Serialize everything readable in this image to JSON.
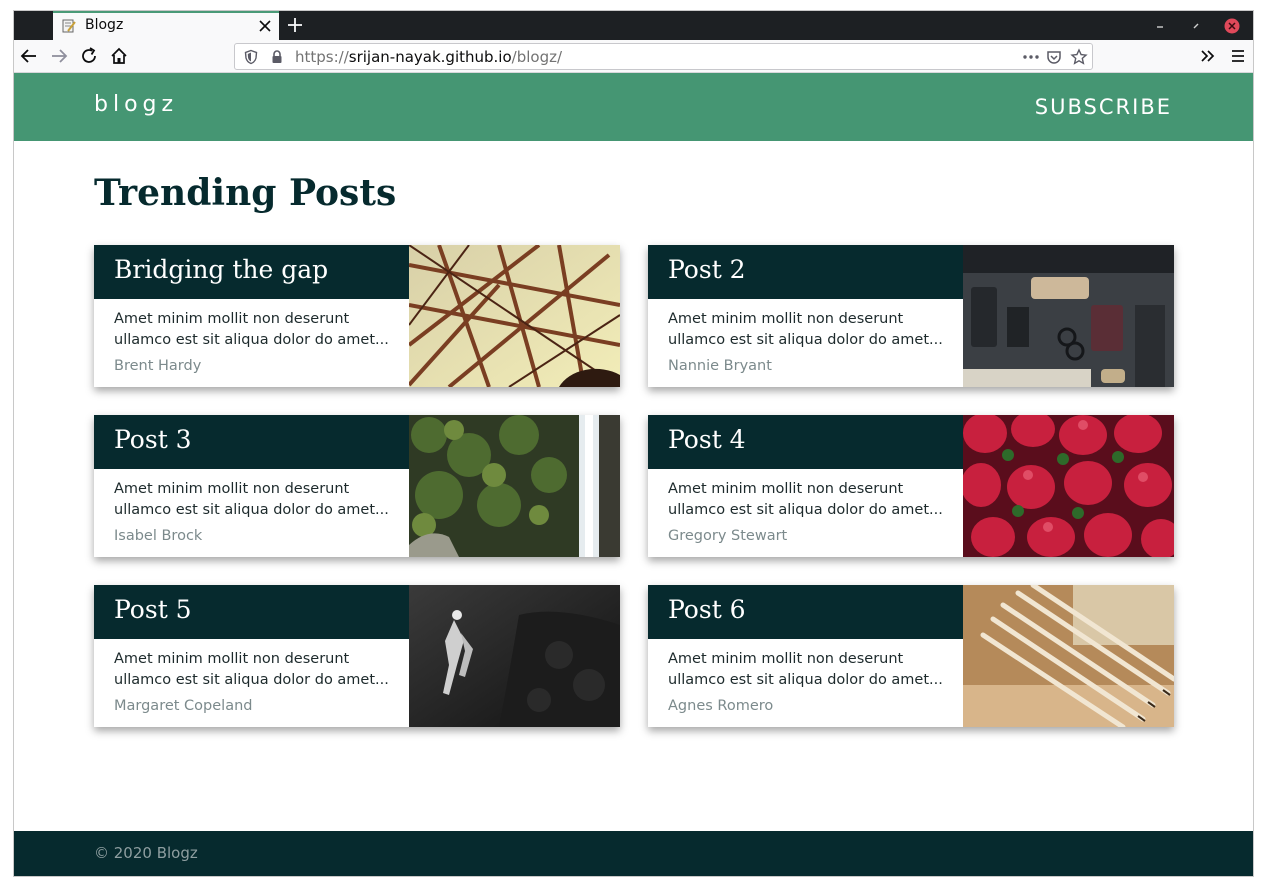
{
  "browser": {
    "tab_title": "Blogz",
    "url_scheme": "https://",
    "url_host": "srijan-nayak.github.io",
    "url_path": "/blogz/"
  },
  "site": {
    "logo": "blogz",
    "subscribe_label": "SUBSCRIBE",
    "accent_color": "#459673",
    "dark_color": "#062a2e"
  },
  "main": {
    "title": "Trending Posts",
    "posts": [
      {
        "title": "Bridging the gap",
        "excerpt": "Amet minim mollit non deserunt ullamco est sit aliqua dolor do amet...",
        "author": "Brent Hardy",
        "image": "steel-bridge-photo"
      },
      {
        "title": "Post 2",
        "excerpt": "Amet minim mollit non deserunt ullamco est sit aliqua dolor do amet...",
        "author": "Nannie Bryant",
        "image": "desk-flatlay-photo"
      },
      {
        "title": "Post 3",
        "excerpt": "Amet minim mollit non deserunt ullamco est sit aliqua dolor do amet...",
        "author": "Isabel Brock",
        "image": "waterfall-photo"
      },
      {
        "title": "Post 4",
        "excerpt": "Amet minim mollit non deserunt ullamco est sit aliqua dolor do amet...",
        "author": "Gregory Stewart",
        "image": "strawberries-photo"
      },
      {
        "title": "Post 5",
        "excerpt": "Amet minim mollit non deserunt ullamco est sit aliqua dolor do amet...",
        "author": "Margaret Copeland",
        "image": "scuba-diver-photo"
      },
      {
        "title": "Post 6",
        "excerpt": "Amet minim mollit non deserunt ullamco est sit aliqua dolor do amet...",
        "author": "Agnes Romero",
        "image": "pencils-photo"
      }
    ]
  },
  "footer": {
    "text": "© 2020 Blogz"
  }
}
